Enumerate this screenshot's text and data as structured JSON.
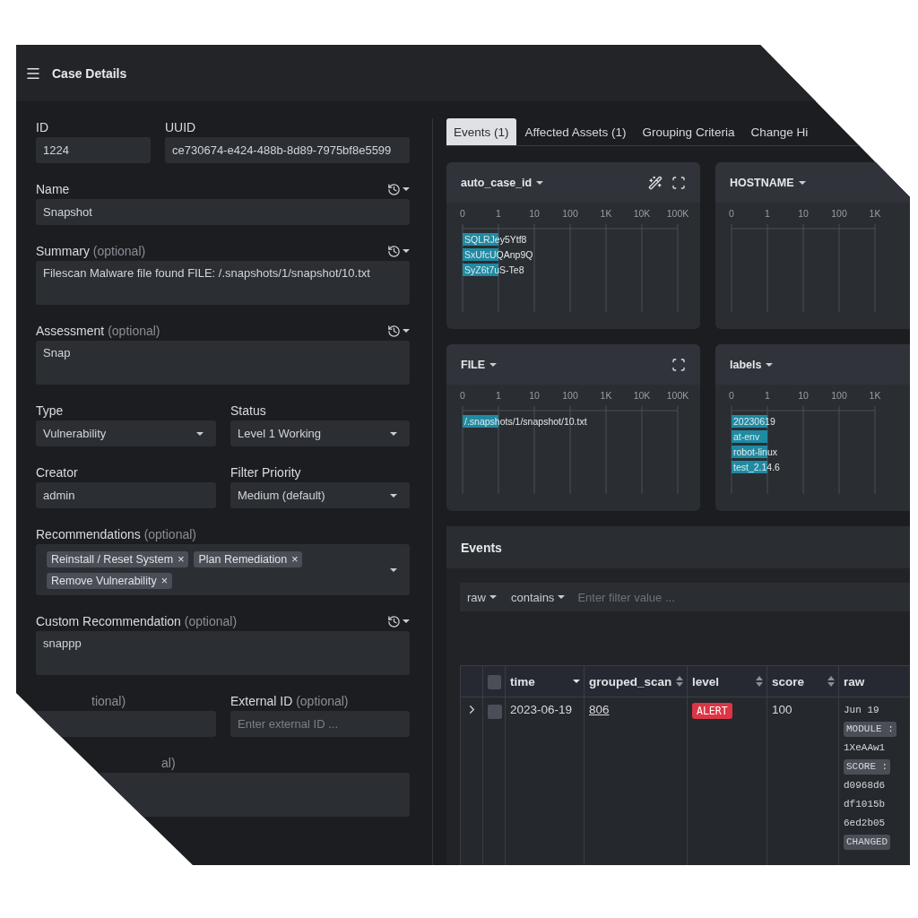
{
  "header": {
    "title": "Case Details"
  },
  "form": {
    "rows": [
      {
        "fields": [
          {
            "label": "ID",
            "kind": "text",
            "value": "1224",
            "history": false
          },
          {
            "label": "UUID",
            "kind": "text",
            "value": "ce730674-e424-488b-8d89-7975bf8e5599",
            "history": false
          }
        ]
      },
      {
        "fields": [
          {
            "label": "Name",
            "kind": "text",
            "value": "Snapshot",
            "history": true
          }
        ]
      },
      {
        "fields": [
          {
            "label": "Summary",
            "note": "(optional)",
            "kind": "textarea",
            "value": "Filescan Malware file found FILE: /.snapshots/1/snapshot/10.txt",
            "history": true
          }
        ]
      },
      {
        "fields": [
          {
            "label": "Assessment",
            "note": "(optional)",
            "kind": "textarea",
            "value": "Snap",
            "history": true
          }
        ]
      },
      {
        "fields": [
          {
            "label": "Type",
            "kind": "select",
            "value": "Vulnerability",
            "history": false
          },
          {
            "label": "Status",
            "kind": "select",
            "value": "Level 1 Working",
            "history": false
          }
        ]
      },
      {
        "fields": [
          {
            "label": "Creator",
            "kind": "text",
            "value": "admin",
            "history": false
          },
          {
            "label": "Filter Priority",
            "kind": "select",
            "value": "Medium (default)",
            "history": false
          }
        ]
      },
      {
        "fields": [
          {
            "label": "Recommendations",
            "note": "(optional)",
            "kind": "tags",
            "tags": [
              {
                "label": "Reinstall / Reset System",
                "remove": "×"
              },
              {
                "label": "Plan Remediation",
                "remove": "×"
              },
              {
                "label": "Remove Vulnerability",
                "remove": "×"
              }
            ],
            "history": false
          }
        ]
      },
      {
        "fields": [
          {
            "label": "Custom Recommendation",
            "note": "(optional)",
            "kind": "textarea",
            "value": "snappp",
            "history": true
          }
        ]
      },
      {
        "fields": [
          {
            "note": "tional)",
            "kind": "text",
            "history": false
          },
          {
            "label": "External ID",
            "note": "(optional)",
            "kind": "text",
            "placeholder": "Enter external ID ...",
            "history": false
          }
        ]
      },
      {
        "fields": [
          {
            "note": "al)",
            "kind": "textarea",
            "history": false
          }
        ]
      }
    ]
  },
  "tabs": [
    {
      "label": "Events (1)",
      "selected": true
    },
    {
      "label": "Affected Assets (1)",
      "selected": false
    },
    {
      "label": "Grouping Criteria",
      "selected": false
    },
    {
      "label": "Change Hi",
      "selected": false
    }
  ],
  "charts": [
    {
      "title": "auto_case_id",
      "actions": [
        {
          "kind": "wand"
        },
        {
          "kind": "expand"
        }
      ],
      "axis_labels": [
        "0",
        "1",
        "10",
        "100",
        "1K",
        "10K",
        "100K"
      ],
      "bars": [
        {
          "label": "SQLRJey5Ytf8",
          "level": 0.167
        },
        {
          "label": "SxUfcUQAnp9Q",
          "level": 0.167
        },
        {
          "label": "SyZ6t7uS-Te8",
          "level": 0.167
        }
      ]
    },
    {
      "title": "HOSTNAME",
      "axis_labels": [
        "0",
        "1",
        "10",
        "100",
        "1K"
      ]
    },
    {
      "title": "FILE",
      "actions": [
        {
          "kind": "expand"
        }
      ],
      "axis_labels": [
        "0",
        "1",
        "10",
        "100",
        "1K",
        "10K",
        "100K"
      ],
      "bars": [
        {
          "label": "/.snapshots/1/snapshot/10.txt",
          "level": 0.167
        }
      ]
    },
    {
      "title": "labels",
      "axis_labels": [
        "0",
        "1",
        "10",
        "100",
        "1K"
      ],
      "bars": [
        {
          "label": "20230619",
          "level": 0.167
        },
        {
          "label": "at-env",
          "level": 0.167
        },
        {
          "label": "robot-linux",
          "level": 0.167
        },
        {
          "label": "test_2.14.6",
          "level": 0.167
        }
      ]
    }
  ],
  "events": {
    "title": "Events",
    "filter": {
      "field": "raw",
      "operator": "contains",
      "placeholder": "Enter filter value ..."
    },
    "header_checked": false,
    "columns": [
      {
        "label": "time",
        "sorted": true
      },
      {
        "label": "grouped_scan",
        "sorted": false
      },
      {
        "label": "level",
        "sorted": false
      },
      {
        "label": "score",
        "sorted": false
      },
      {
        "label": "raw"
      }
    ],
    "rows": [
      {
        "expanded": false,
        "checked": false,
        "time": "2023-06-19",
        "grouped_scan": "806",
        "level": {
          "text": "ALERT",
          "color": "#dc3545"
        },
        "score": "100",
        "raw": [
          {
            "kind": "text",
            "text": "Jun 19"
          },
          {
            "kind": "chip",
            "text": "MODULE :"
          },
          {
            "kind": "text",
            "text": "1XeAAw1"
          },
          {
            "kind": "chip",
            "text": "SCORE :"
          },
          {
            "kind": "text",
            "text": "d0968d6"
          },
          {
            "kind": "text",
            "text": "df1015b"
          },
          {
            "kind": "text",
            "text": "6ed2b05"
          },
          {
            "kind": "chip",
            "text": "CHANGED"
          }
        ]
      }
    ]
  }
}
